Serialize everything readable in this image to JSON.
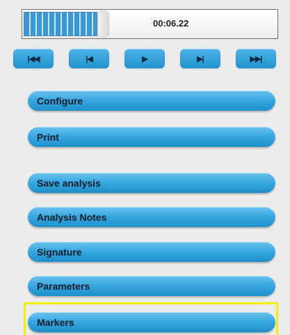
{
  "playback": {
    "time": "00:06.22",
    "progress_fraction": 0.29
  },
  "transport": [
    {
      "name": "skip-to-start-button",
      "label": "|◀◀"
    },
    {
      "name": "step-back-button",
      "label": "|◀"
    },
    {
      "name": "play-button",
      "label": "▶"
    },
    {
      "name": "step-forward-button",
      "label": "▶|"
    },
    {
      "name": "skip-to-end-button",
      "label": "▶▶|"
    }
  ],
  "menu": [
    {
      "name": "configure-button",
      "label": "Configure"
    },
    {
      "name": "print-button",
      "label": "Print"
    },
    {
      "name": "save-analysis-button",
      "label": "Save analysis"
    },
    {
      "name": "analysis-notes-button",
      "label": "Analysis Notes"
    },
    {
      "name": "signature-button",
      "label": "Signature"
    },
    {
      "name": "parameters-button",
      "label": "Parameters"
    },
    {
      "name": "markers-button",
      "label": "Markers",
      "selected": true
    }
  ],
  "colors": {
    "accent": "#1f92cf",
    "selection_highlight": "#f2f200"
  }
}
